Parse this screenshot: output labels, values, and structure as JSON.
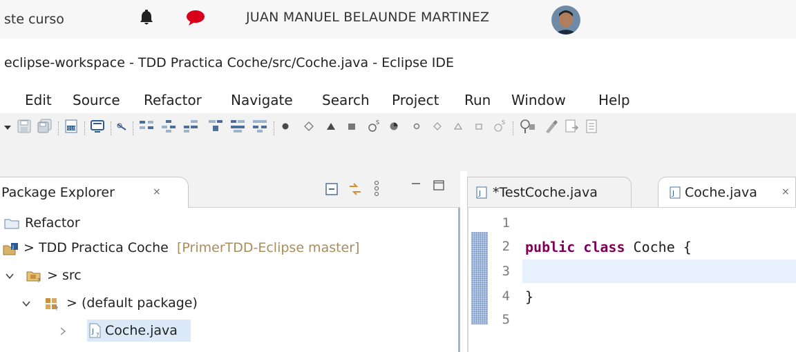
{
  "lms": {
    "course_fragment": "ste curso",
    "user_name": "JUAN MANUEL BELAUNDE MARTINEZ",
    "bell_icon": "bell-icon",
    "message_icon": "speech-bubble-icon",
    "message_color": "#d9001b"
  },
  "window": {
    "title": "eclipse-workspace - TDD Practica Coche/src/Coche.java - Eclipse IDE"
  },
  "menu": {
    "items": [
      "Edit",
      "Source",
      "Refactor",
      "Navigate",
      "Search",
      "Project",
      "Run",
      "Window",
      "Help"
    ]
  },
  "package_explorer": {
    "title": "Package Explorer",
    "close_glyph": "⨯",
    "rows": [
      {
        "label": "Refactor",
        "suffix": ""
      },
      {
        "label": "> TDD Practica Coche",
        "suffix": " [PrimerTDD-Eclipse master]"
      },
      {
        "label": "> src",
        "suffix": ""
      },
      {
        "label": "> (default package)",
        "suffix": ""
      },
      {
        "label": "Coche.java",
        "suffix": ""
      }
    ]
  },
  "editor": {
    "tabs": [
      {
        "label": "*TestCoche.java",
        "active": false
      },
      {
        "label": "Coche.java",
        "active": true
      }
    ],
    "close_glyph": "⨯",
    "line_numbers": [
      "1",
      "2",
      "3",
      "4",
      "5"
    ],
    "code": {
      "line2_keyword1": "public",
      "line2_keyword2": "class",
      "line2_rest": " Coche {",
      "line4": "}"
    },
    "keyword_color": "#7f0055"
  }
}
